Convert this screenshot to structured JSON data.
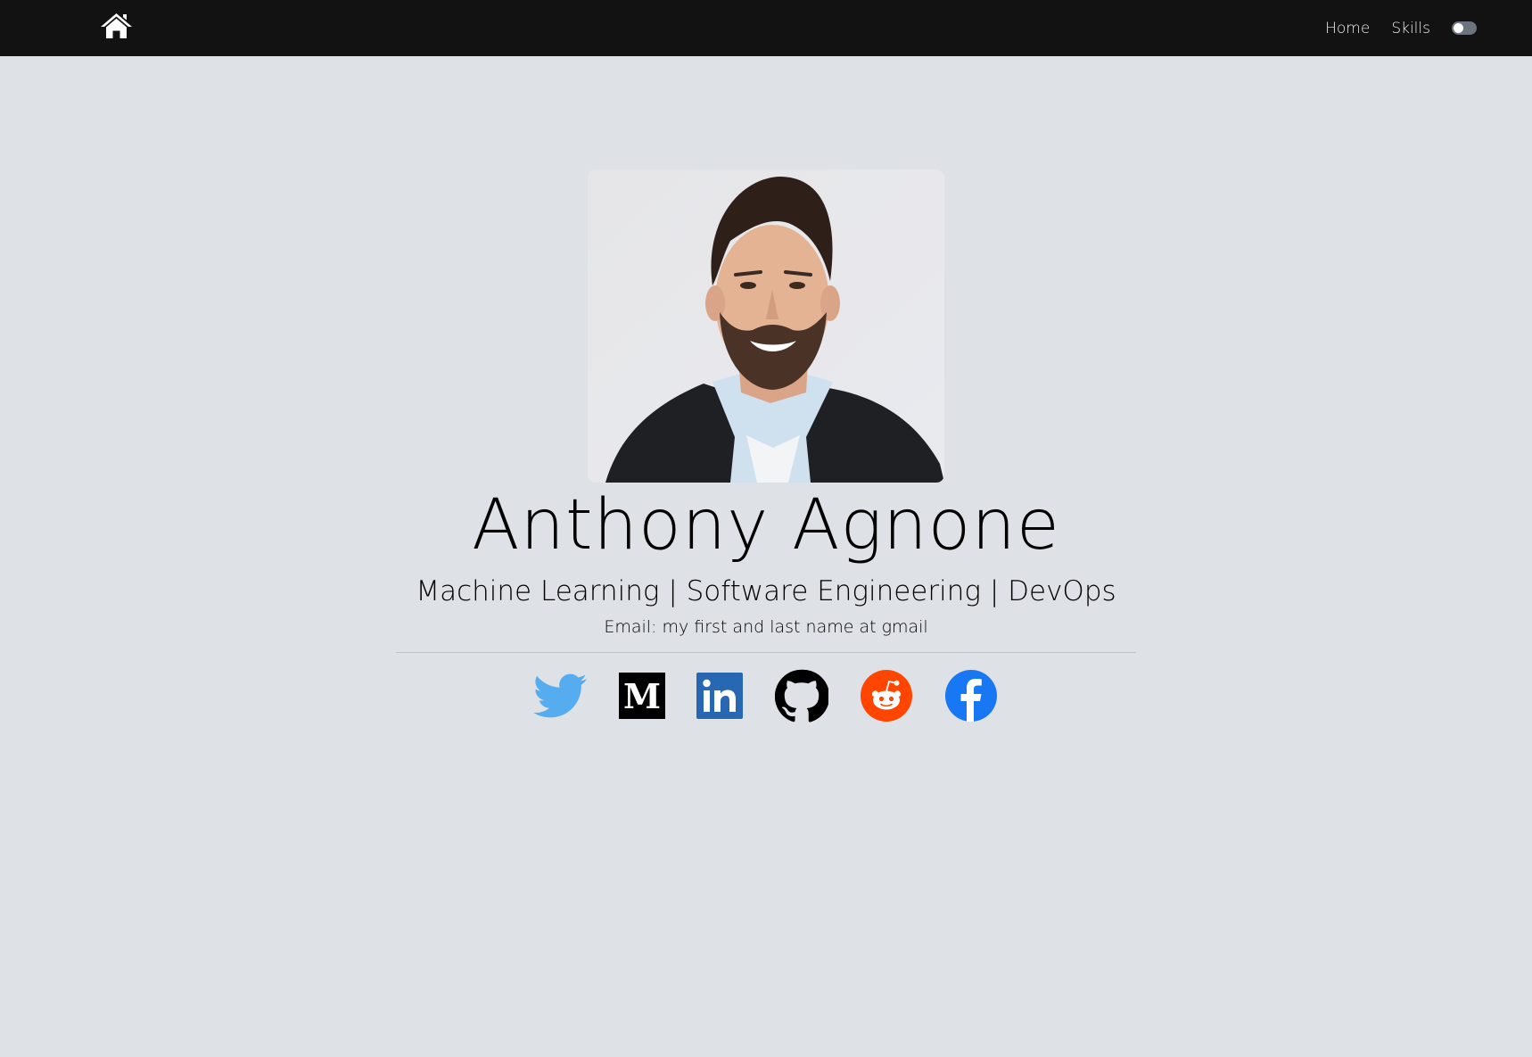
{
  "navbar": {
    "home_icon": "house-icon",
    "links": [
      {
        "label": "Home"
      },
      {
        "label": "Skills"
      }
    ],
    "theme_toggle": {
      "state": "off"
    }
  },
  "profile": {
    "name": "Anthony Agnone",
    "tagline": "Machine Learning | Software Engineering | DevOps",
    "email": "Email: my first and last name at gmail"
  },
  "social": [
    {
      "icon": "twitter-icon",
      "color": "#55acee"
    },
    {
      "icon": "medium-icon",
      "color": "#000000"
    },
    {
      "icon": "linkedin-icon",
      "color": "#2867b2"
    },
    {
      "icon": "github-icon",
      "color": "#000000"
    },
    {
      "icon": "reddit-icon",
      "color": "#ff4500"
    },
    {
      "icon": "facebook-icon",
      "color": "#1877f2"
    }
  ],
  "colors": {
    "navbar_bg": "#121212",
    "page_bg": "#dee1e5"
  }
}
